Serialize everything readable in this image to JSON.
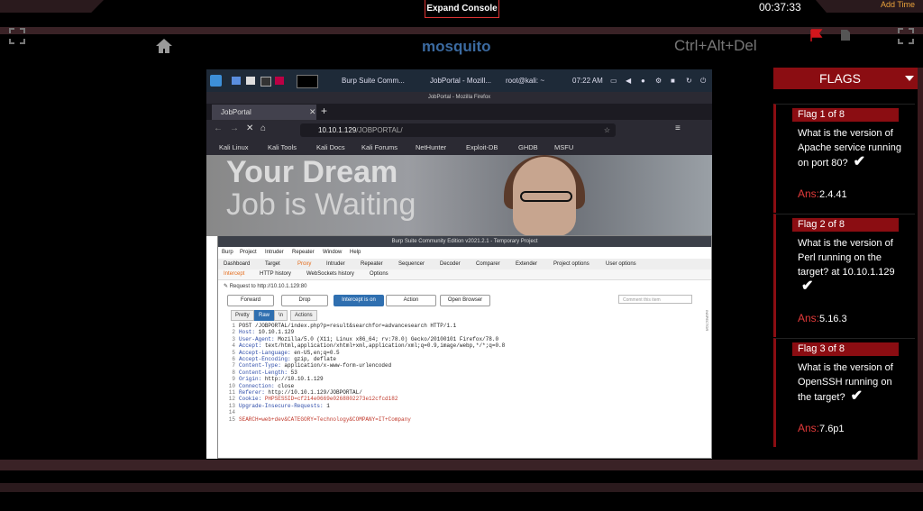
{
  "header": {
    "expand_console": "Expand Console",
    "timer": "00:37:33",
    "add_time": "Add Time",
    "machine_name": "mosquito",
    "ctrl_alt_del": "Ctrl+Alt+Del"
  },
  "vm": {
    "taskbar": {
      "burp_task": "Burp Suite Comm...",
      "firefox_task": "JobPortal - Mozill...",
      "terminal_task": "root@kali: ~",
      "clock": "07:22 AM"
    },
    "firefox": {
      "window_title": "JobPortal - Mozilla Firefox",
      "tab_label": "JobPortal",
      "url_host": "10.10.1.129",
      "url_path": "/JOBPORTAL/",
      "bookmarks": [
        "Kali Linux",
        "Kali Tools",
        "Kali Docs",
        "Kali Forums",
        "NetHunter",
        "Exploit-DB",
        "GHDB",
        "MSFU"
      ]
    },
    "hero": {
      "line1": "Your Dream",
      "line2": "Job is Waiting"
    },
    "burp": {
      "title": "Burp Suite Community Edition v2021.2.1 - Temporary Project",
      "menu": [
        "Burp",
        "Project",
        "Intruder",
        "Repeater",
        "Window",
        "Help"
      ],
      "tabs": [
        "Dashboard",
        "Target",
        "Proxy",
        "Intruder",
        "Repeater",
        "Sequencer",
        "Decoder",
        "Comparer",
        "Extender",
        "Project options",
        "User options"
      ],
      "subtabs": [
        "Intercept",
        "HTTP history",
        "WebSockets history",
        "Options"
      ],
      "request_info": "Request to http://10.10.1.129:80",
      "buttons": {
        "forward": "Forward",
        "drop": "Drop",
        "intercept": "Intercept is on",
        "action": "Action",
        "open_browser": "Open Browser"
      },
      "comment_placeholder": "Comment this item",
      "formats": [
        "Pretty",
        "Raw",
        "\\n",
        "Actions"
      ],
      "inspector_label": "INSPECTOR",
      "request_lines": [
        {
          "n": "1",
          "k": "",
          "v": "POST /JOBPORTAL/index.php?p=result&searchfor=advancesearch HTTP/1.1"
        },
        {
          "n": "2",
          "k": "Host:",
          "v": " 10.10.1.129"
        },
        {
          "n": "3",
          "k": "User-Agent:",
          "v": " Mozilla/5.0 (X11; Linux x86_64; rv:78.0) Gecko/20100101 Firefox/78.0"
        },
        {
          "n": "4",
          "k": "Accept:",
          "v": " text/html,application/xhtml+xml,application/xml;q=0.9,image/webp,*/*;q=0.8"
        },
        {
          "n": "5",
          "k": "Accept-Language:",
          "v": " en-US,en;q=0.5"
        },
        {
          "n": "6",
          "k": "Accept-Encoding:",
          "v": " gzip, deflate"
        },
        {
          "n": "7",
          "k": "Content-Type:",
          "v": " application/x-www-form-urlencoded"
        },
        {
          "n": "8",
          "k": "Content-Length:",
          "v": " 53"
        },
        {
          "n": "9",
          "k": "Origin:",
          "v": " http://10.10.1.129"
        },
        {
          "n": "10",
          "k": "Connection:",
          "v": " close"
        },
        {
          "n": "11",
          "k": "Referer:",
          "v": " http://10.10.1.129/JOBPORTAL/"
        },
        {
          "n": "12",
          "k": "Cookie:",
          "v": " PHPSESSID=cf214e0669e0268802273e12cfcd182"
        },
        {
          "n": "13",
          "k": "Upgrade-Insecure-Requests:",
          "v": " 1"
        },
        {
          "n": "14",
          "k": "",
          "v": ""
        },
        {
          "n": "15",
          "k": "",
          "v": "SEARCH=web+dev&CATEGORY=Technology&COMPANY=IT+Company"
        }
      ]
    }
  },
  "flags": {
    "title": "FLAGS",
    "items": [
      {
        "head": "Flag 1 of 8",
        "question": "What is the version of Apache service running on port 80?",
        "ans_label": "Ans:",
        "answer": "2.4.41"
      },
      {
        "head": "Flag 2 of 8",
        "question": "What is the version of Perl running on the target? at 10.10.1.129",
        "ans_label": "Ans:",
        "answer": "5.16.3"
      },
      {
        "head": "Flag 3 of 8",
        "question": "What is the version of OpenSSH running on the target?",
        "ans_label": "Ans:",
        "answer": "7.6p1"
      }
    ]
  }
}
